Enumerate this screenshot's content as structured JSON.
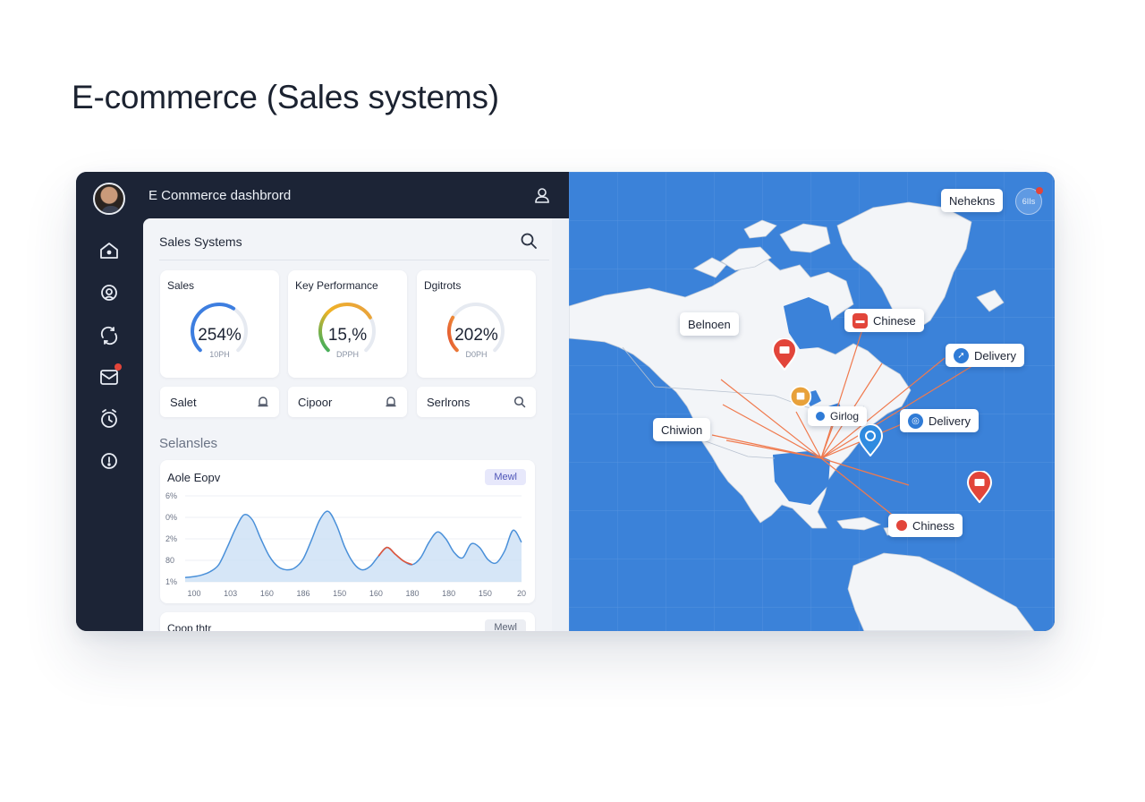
{
  "page": {
    "heading": "E-commerce (Sales systems)"
  },
  "app": {
    "title": "E Commerce dashbrord"
  },
  "sidebar": {
    "icons": [
      "home-icon",
      "profile-icon",
      "sync-icon",
      "mail-icon",
      "clock-icon",
      "info-icon"
    ]
  },
  "panel": {
    "title": "Sales Systems",
    "kpis": [
      {
        "label": "Sales",
        "value": "254%",
        "sub": "10PH",
        "level": 0.62,
        "colors": [
          "#3d7ee0"
        ]
      },
      {
        "label": "Key Performance",
        "value": "15,%",
        "sub": "DPPH",
        "level": 0.72,
        "colors": [
          "#2fae62",
          "#f0b324",
          "#e8a040"
        ]
      },
      {
        "label": "Dgitrots",
        "value": "202%",
        "sub": "D0PH",
        "level": 0.28,
        "colors": [
          "#e5522f",
          "#f09b3a"
        ]
      }
    ],
    "pills": [
      {
        "label": "Salet",
        "icon": "bell-icon"
      },
      {
        "label": "Cipoor",
        "icon": "bell-icon"
      },
      {
        "label": "Serlrons",
        "icon": "search-icon"
      }
    ],
    "section_label": "Selansles",
    "chart_card": {
      "title": "Aole Eopv",
      "badge": "Mewl"
    },
    "card2": {
      "title": "Cpop thtr",
      "badge": "Mewl"
    }
  },
  "chart_data": {
    "type": "area",
    "y_tick_labels": [
      "6%",
      "0%",
      "2%",
      "80",
      "1%"
    ],
    "x_tick_labels": [
      "100",
      "103",
      "160",
      "186",
      "150",
      "160",
      "180",
      "180",
      "150",
      "20"
    ],
    "ylim": [
      0,
      100
    ],
    "x": [
      0,
      2,
      4,
      6,
      8,
      10,
      12,
      14,
      16,
      18,
      20,
      22,
      24,
      26,
      28,
      30,
      32,
      34,
      36,
      38,
      40,
      42,
      44,
      46,
      48,
      50,
      52,
      54,
      56,
      58,
      60,
      62,
      64,
      66,
      68,
      70,
      72,
      74,
      76,
      78,
      80
    ],
    "series": [
      {
        "values": [
          5,
          6,
          8,
          12,
          20,
          40,
          62,
          78,
          72,
          50,
          30,
          18,
          14,
          16,
          26,
          48,
          72,
          82,
          66,
          40,
          22,
          14,
          18,
          30,
          40,
          32,
          24,
          20,
          28,
          46,
          58,
          50,
          34,
          28,
          44,
          40,
          26,
          22,
          36,
          60,
          46
        ],
        "color": "#4a90d9"
      }
    ],
    "highlight_range": [
      48,
      52
    ],
    "highlight_color": "#e0563b",
    "grid": true
  },
  "map": {
    "callouts": [
      {
        "label": "Nehekns",
        "icon": "",
        "color": ""
      },
      {
        "label": "Belnoen",
        "icon": "",
        "color": ""
      },
      {
        "label": "Chinese",
        "icon": "flag-icon",
        "color": "#e2453a"
      },
      {
        "label": "Delivery",
        "icon": "delivery-icon",
        "color": "#2f7bd6"
      },
      {
        "label": "Chiwion",
        "icon": "",
        "color": ""
      },
      {
        "label": "Girlog",
        "icon": "dot-icon",
        "color": "#2f7bd6"
      },
      {
        "label": "Delivery",
        "icon": "delivery-icon",
        "color": "#2f7bd6"
      },
      {
        "label": "Chiness",
        "icon": "dot-icon",
        "color": "#e2453a"
      }
    ],
    "mini_button": "6IIs",
    "colors": {
      "ocean": "#3b82d9",
      "land": "#f3f5f8",
      "route": "#f07a4e"
    }
  }
}
